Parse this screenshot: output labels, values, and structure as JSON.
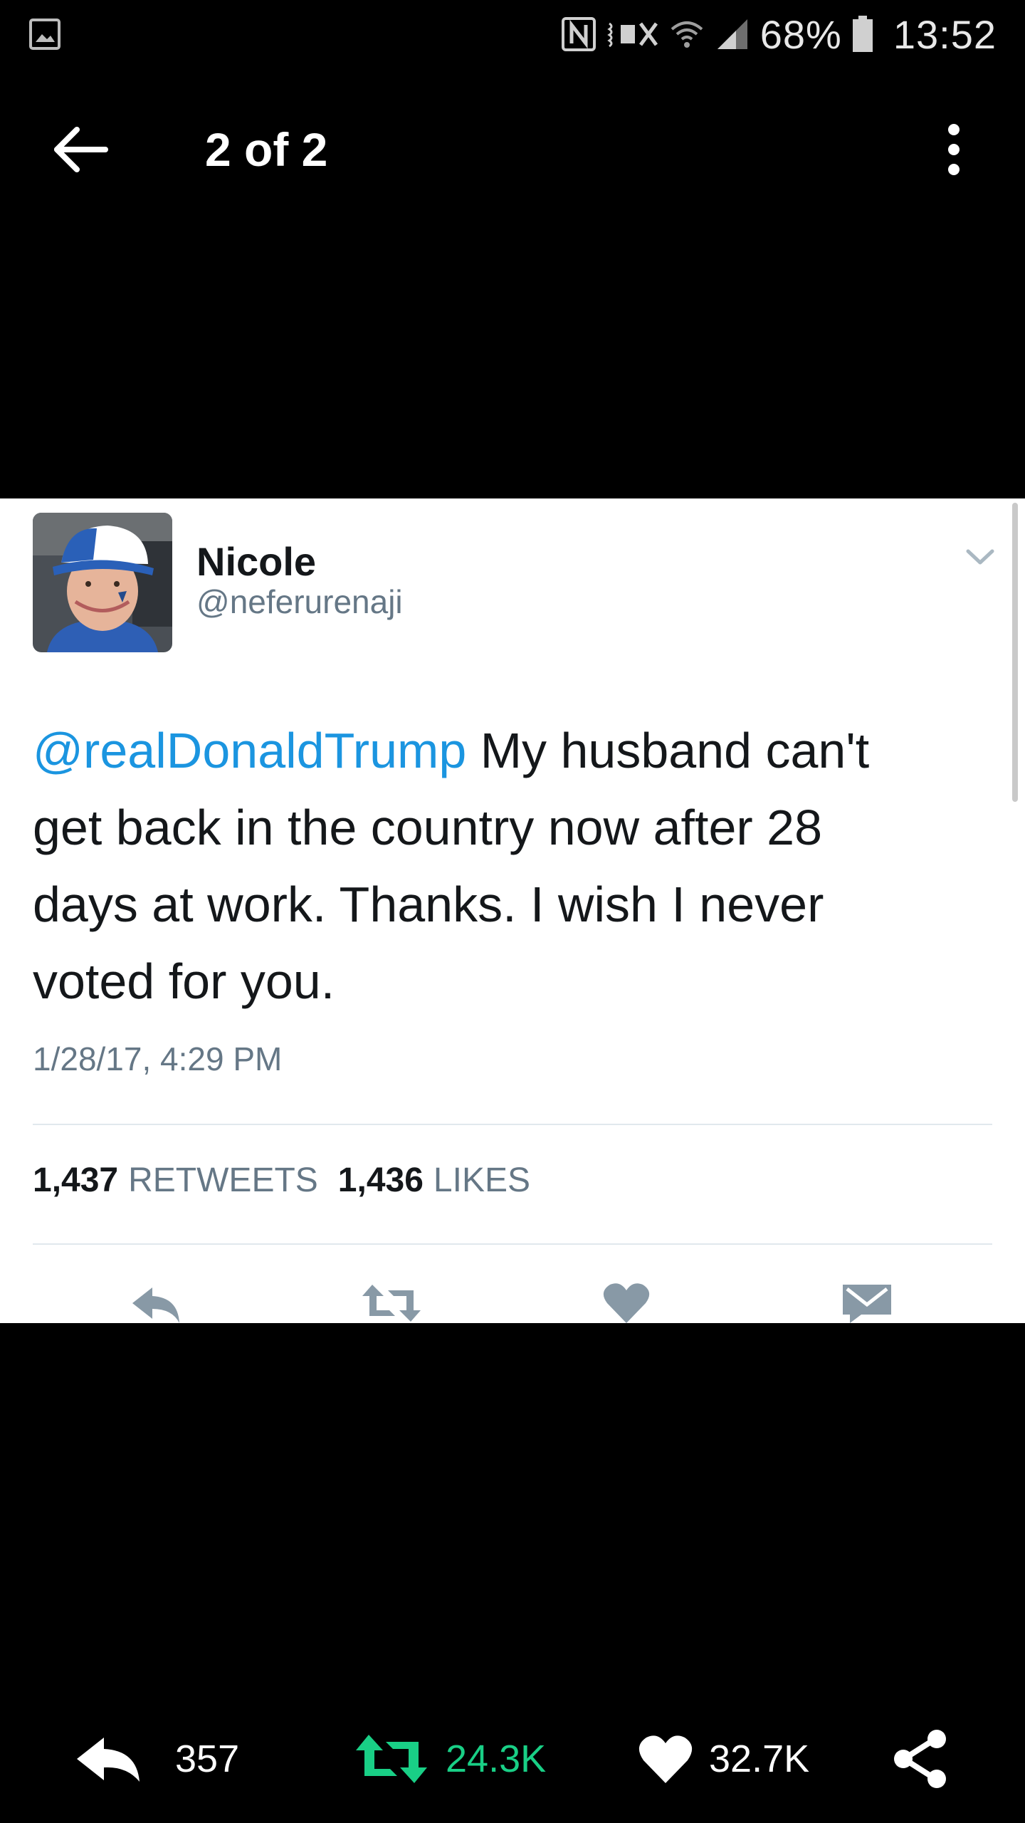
{
  "status_bar": {
    "battery_percent": "68%",
    "time": "13:52",
    "icons": [
      "gallery-icon",
      "nfc-icon",
      "mute-icon",
      "wifi-icon",
      "signal-icon",
      "battery-icon"
    ]
  },
  "app_bar": {
    "counter": "2 of 2",
    "icons": [
      "back-arrow-icon",
      "overflow-menu-icon"
    ]
  },
  "tweet": {
    "display_name": "Nicole",
    "handle": "@neferurenaji",
    "mention": "@realDonaldTrump",
    "text_line_1": " My husband can't",
    "text_line_2": "get back in the country now after 28",
    "text_line_3": "days at work.  Thanks.  I wish I never",
    "text_line_4": "voted for you.",
    "timestamp": "1/28/17, 4:29 PM",
    "retweets_count": "1,437",
    "retweets_label": "RETWEETS",
    "likes_count": "1,436",
    "likes_label": "LIKES",
    "colors": {
      "mention": "#1b95e0",
      "meta": "#657786",
      "text": "#14171a"
    }
  },
  "bottom_bar": {
    "reply_count": "357",
    "retweet_count": "24.3K",
    "like_count": "32.7K",
    "colors": {
      "retweet": "#19cf86",
      "default": "#ffffff"
    }
  }
}
